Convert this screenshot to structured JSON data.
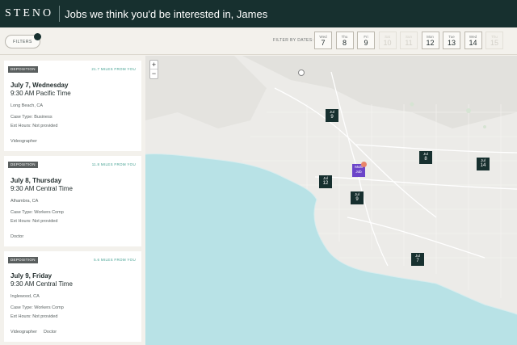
{
  "header": {
    "logo": "STENO",
    "headline": "Jobs we think you'd be interested in, James"
  },
  "filters": {
    "button_label": "FILTERS",
    "date_label": "FILTER BY DATES:",
    "dates": [
      {
        "dow": "Wed",
        "num": "7",
        "enabled": true
      },
      {
        "dow": "Thu",
        "num": "8",
        "enabled": true
      },
      {
        "dow": "Fri",
        "num": "9",
        "enabled": true
      },
      {
        "dow": "Sat",
        "num": "10",
        "enabled": false
      },
      {
        "dow": "Sun",
        "num": "11",
        "enabled": false
      },
      {
        "dow": "Mon",
        "num": "12",
        "enabled": true
      },
      {
        "dow": "Tue",
        "num": "13",
        "enabled": true
      },
      {
        "dow": "Wed",
        "num": "14",
        "enabled": true
      },
      {
        "dow": "Thu",
        "num": "15",
        "enabled": false
      }
    ]
  },
  "jobs": [
    {
      "tag": "DEPOSITION",
      "miles": "21.7 MILES FROM YOU",
      "day": "July 7, Wednesday",
      "time": "9:30 AM Pacific Time",
      "city": "Long Beach, CA",
      "case_type": "Case Type: Business",
      "ext_hours": "Ext Hours: Not provided",
      "roles": [
        "Videographer"
      ]
    },
    {
      "tag": "DEPOSITION",
      "miles": "11.8 MILES FROM YOU",
      "day": "July 8, Thursday",
      "time": "9:30 AM Central Time",
      "city": "Alhambra, CA",
      "case_type": "Case Type: Workers Comp",
      "ext_hours": "Ext Hours: Not provided",
      "roles": [
        "Doctor"
      ]
    },
    {
      "tag": "DEPOSITION",
      "miles": "5.6 MILES FROM YOU",
      "day": "July 9, Friday",
      "time": "9:30 AM Central Time",
      "city": "Inglewood, CA",
      "case_type": "Case Type: Workers Comp",
      "ext_hours": "Ext Hours: Not provided",
      "roles": [
        "Videographer",
        "Doctor"
      ]
    }
  ],
  "map": {
    "zoom_in": "+",
    "zoom_out": "−",
    "pins": [
      {
        "month": "Jul",
        "day": "9"
      },
      {
        "month": "Jul",
        "day": "8"
      },
      {
        "month": "Jul",
        "day": "14"
      },
      {
        "month": "Jul",
        "day": "12"
      },
      {
        "month": "Multi",
        "day": "Job"
      },
      {
        "month": "Jul",
        "day": "9"
      },
      {
        "month": "Jul",
        "day": "7"
      }
    ]
  },
  "colors": {
    "brand": "#17302f",
    "accent": "#3f9e8f",
    "multi_pin": "#6c45c9",
    "ocean": "#b8e2e6",
    "land": "#ecebe8"
  }
}
